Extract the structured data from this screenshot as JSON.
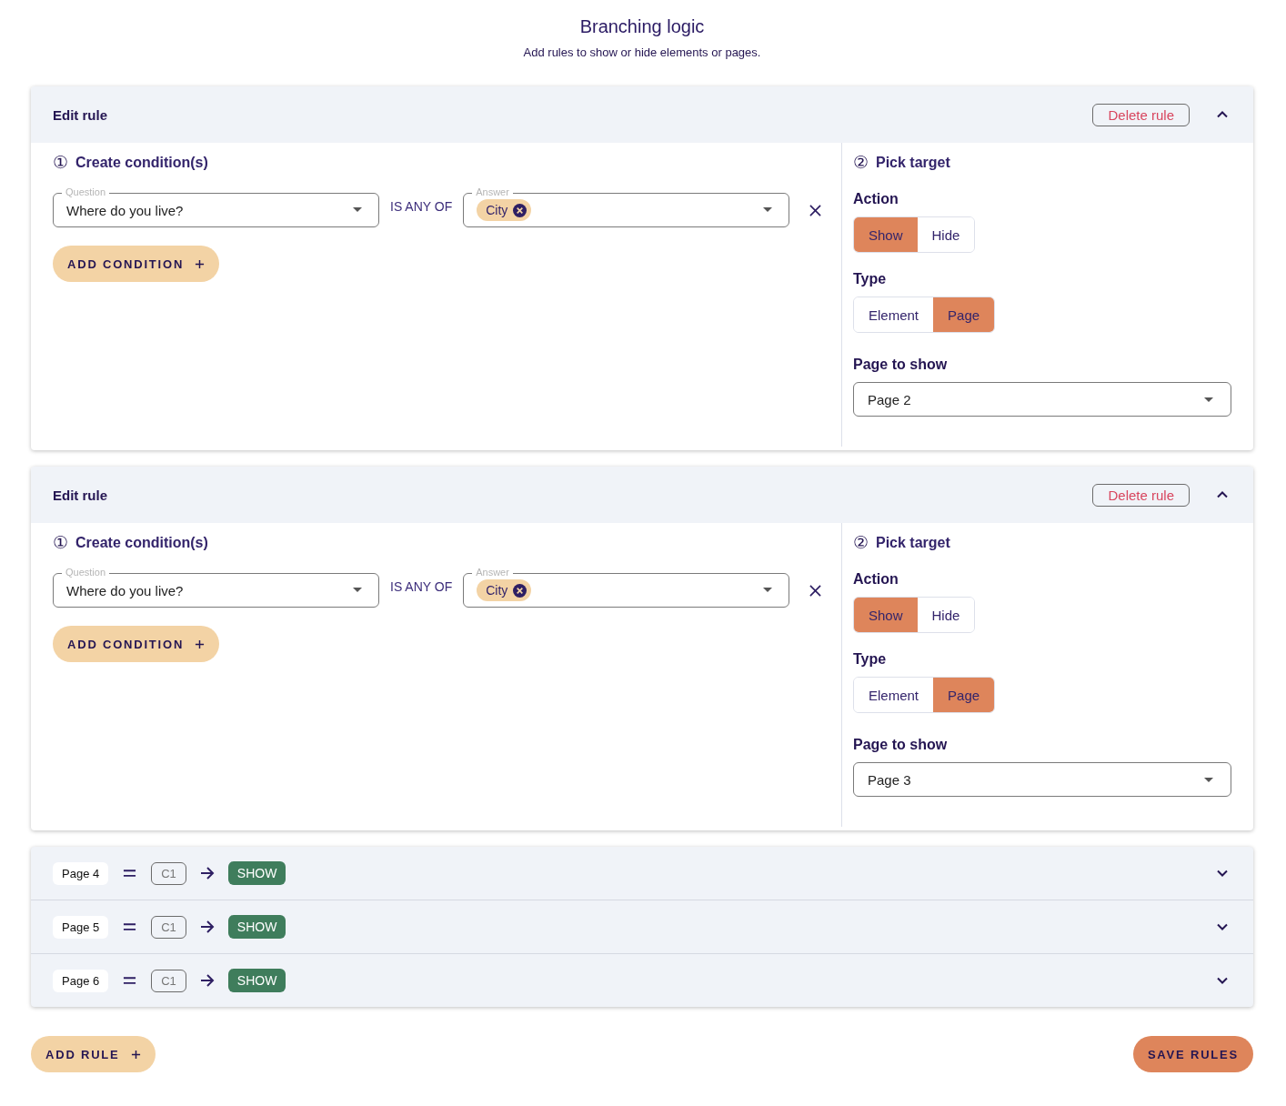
{
  "header": {
    "title": "Branching logic",
    "subtitle": "Add rules to show or hide elements or pages."
  },
  "rules": [
    {
      "expanded": true,
      "title": "Edit rule",
      "delete_label": "Delete rule",
      "conditions": {
        "step": "①",
        "heading": "Create condition(s)",
        "items": [
          {
            "question_label": "Question",
            "question": "Where do you live?",
            "operator": "IS ANY OF",
            "answer_label": "Answer",
            "answers": [
              "City"
            ]
          }
        ],
        "add_label": "ADD CONDITION"
      },
      "target": {
        "step": "②",
        "heading": "Pick target",
        "action_label": "Action",
        "actions": [
          {
            "label": "Show",
            "selected": true
          },
          {
            "label": "Hide",
            "selected": false
          }
        ],
        "type_label": "Type",
        "types": [
          {
            "label": "Element",
            "selected": false
          },
          {
            "label": "Page",
            "selected": true
          }
        ],
        "page_label": "Page to show",
        "page": "Page 2"
      }
    },
    {
      "expanded": true,
      "title": "Edit rule",
      "delete_label": "Delete rule",
      "conditions": {
        "step": "①",
        "heading": "Create condition(s)",
        "items": [
          {
            "question_label": "Question",
            "question": "Where do you live?",
            "operator": "IS ANY OF",
            "answer_label": "Answer",
            "answers": [
              "City"
            ]
          }
        ],
        "add_label": "ADD CONDITION"
      },
      "target": {
        "step": "②",
        "heading": "Pick target",
        "action_label": "Action",
        "actions": [
          {
            "label": "Show",
            "selected": true
          },
          {
            "label": "Hide",
            "selected": false
          }
        ],
        "type_label": "Type",
        "types": [
          {
            "label": "Element",
            "selected": false
          },
          {
            "label": "Page",
            "selected": true
          }
        ],
        "page_label": "Page to show",
        "page": "Page 3"
      }
    }
  ],
  "summaries": [
    {
      "expanded": false,
      "page": "Page 4",
      "condition": "C1",
      "action": "SHOW"
    },
    {
      "expanded": false,
      "page": "Page 5",
      "condition": "C1",
      "action": "SHOW"
    },
    {
      "expanded": false,
      "page": "Page 6",
      "condition": "C1",
      "action": "SHOW"
    }
  ],
  "add_rule": "ADD RULE",
  "save_rules": "SAVE RULES"
}
